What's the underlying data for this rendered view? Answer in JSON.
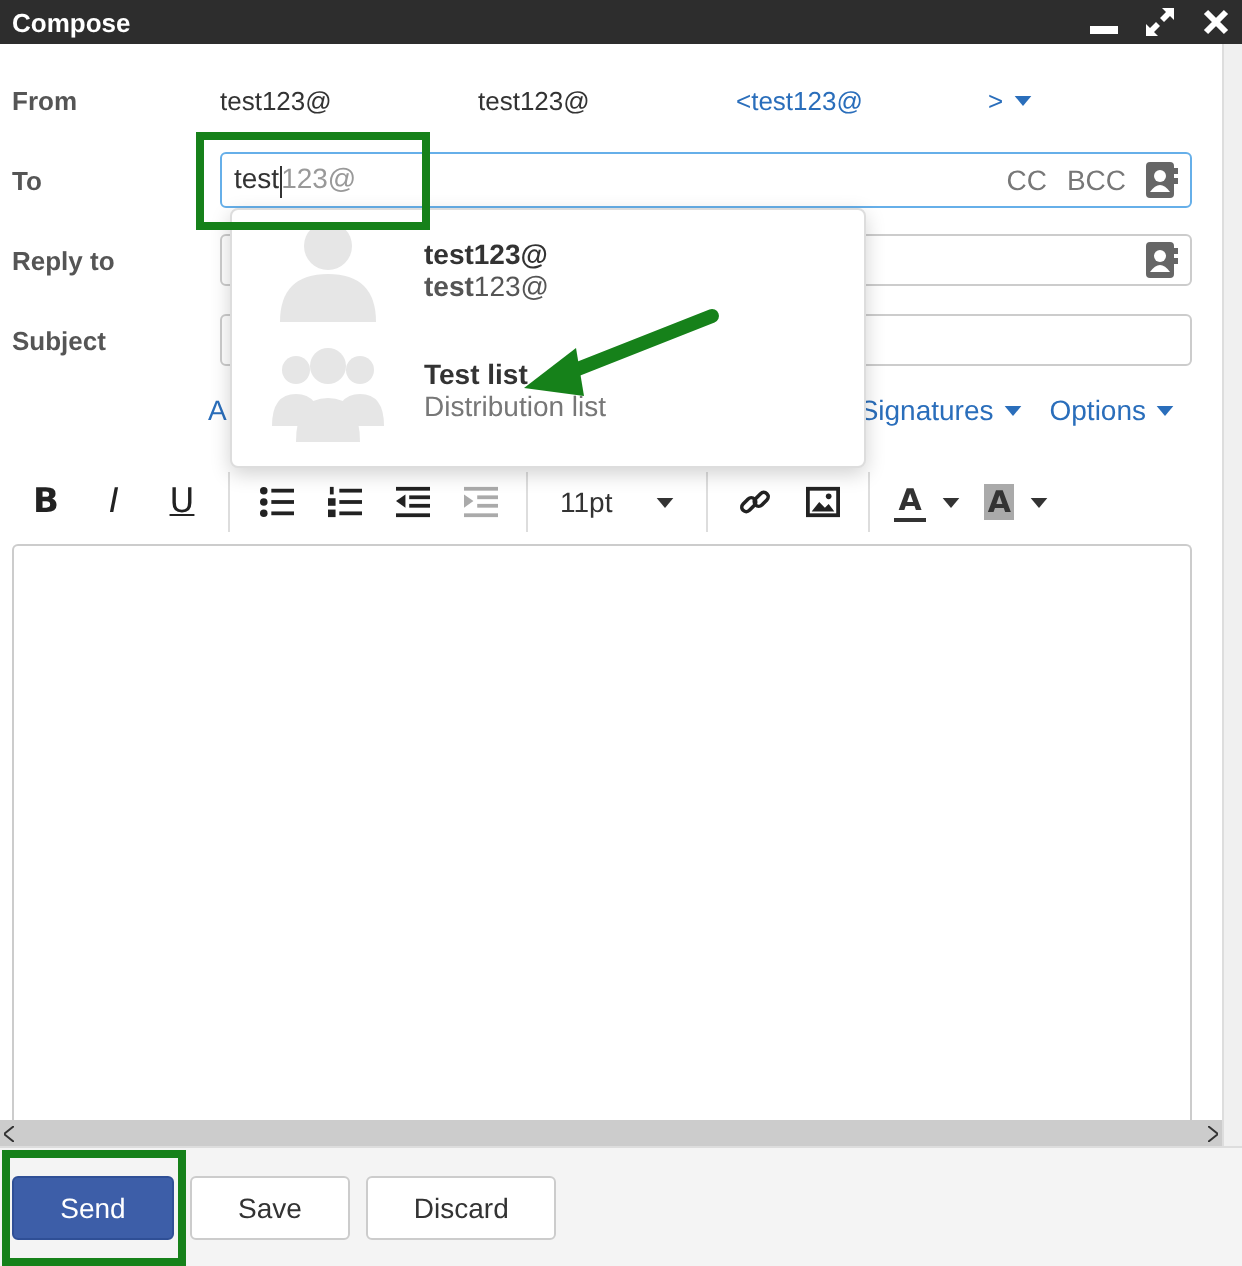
{
  "window": {
    "title": "Compose"
  },
  "from": {
    "label": "From",
    "name": "test123@",
    "address": "test123@",
    "email": "<test123@",
    "email_end": ">"
  },
  "to": {
    "label": "To",
    "value": "test",
    "completion": "123@",
    "links": [
      "CC",
      "BCC"
    ]
  },
  "reply_to": {
    "label": "Reply to"
  },
  "subject": {
    "label": "Subject"
  },
  "links": [
    {
      "label": "A"
    },
    {
      "label": "Signatures"
    },
    {
      "label": "Options"
    }
  ],
  "toolbar": [
    {
      "kind": "bold",
      "label": "B"
    },
    {
      "kind": "italic",
      "label": "I"
    },
    {
      "kind": "underline",
      "label": "U"
    },
    {
      "kind": "sep"
    },
    {
      "kind": "bullets",
      "disabled": false
    },
    {
      "kind": "numbers",
      "disabled": false
    },
    {
      "kind": "outdent",
      "disabled": false
    },
    {
      "kind": "indent",
      "disabled": true
    },
    {
      "kind": "sep"
    },
    {
      "kind": "select",
      "label": "11pt"
    },
    {
      "kind": "sep"
    },
    {
      "kind": "link",
      "disabled": false
    },
    {
      "kind": "image",
      "disabled": false
    },
    {
      "kind": "sep"
    },
    {
      "kind": "forecolor",
      "label": "A"
    },
    {
      "kind": "backcolor",
      "label": "A"
    }
  ],
  "suggestions": [
    {
      "kind": "contact",
      "title": "test123@",
      "subtitle": "**test**123@"
    },
    {
      "kind": "list",
      "title": "Test list",
      "subtitle": "Distribution list"
    }
  ],
  "buttons": [
    {
      "label": "Send",
      "kind": "primary"
    },
    {
      "label": "Save",
      "kind": "default"
    },
    {
      "label": "Discard",
      "kind": "default"
    }
  ]
}
